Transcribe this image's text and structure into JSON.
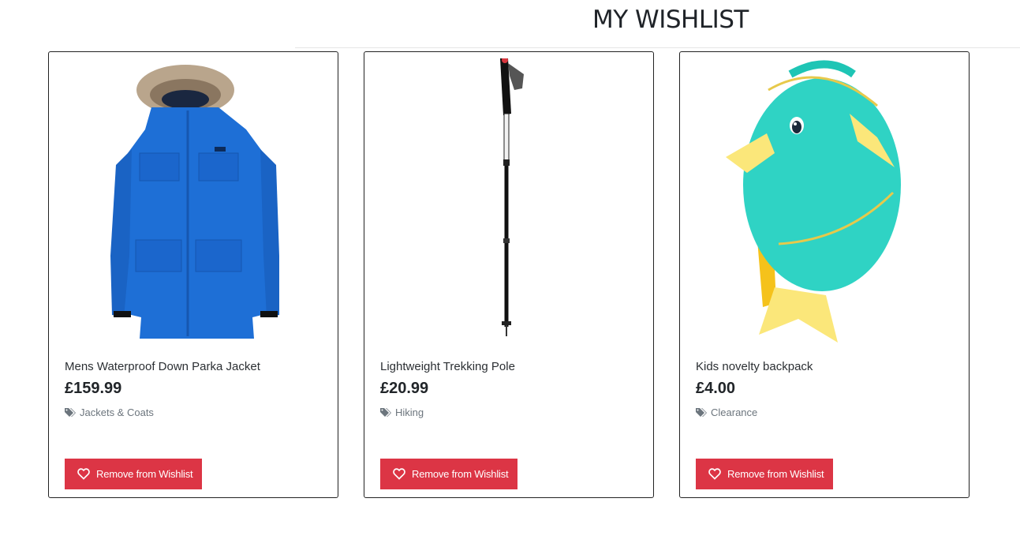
{
  "page": {
    "title": "MY WISHLIST"
  },
  "wishlist": {
    "items": [
      {
        "name": "Mens Waterproof Down Parka Jacket",
        "price": "£159.99",
        "category": "Jackets & Coats",
        "image_icon": "blue-parka-jacket",
        "button_label": "Remove from Wishlist"
      },
      {
        "name": "Lightweight Trekking Pole",
        "price": "£20.99",
        "category": "Hiking",
        "image_icon": "trekking-pole",
        "button_label": "Remove from Wishlist"
      },
      {
        "name": "Kids novelty backpack",
        "price": "£4.00",
        "category": "Clearance",
        "image_icon": "fish-backpack",
        "button_label": "Remove from Wishlist"
      }
    ]
  },
  "colors": {
    "button": "#dc3545",
    "category_text": "#6c757d",
    "card_border": "#222222"
  }
}
